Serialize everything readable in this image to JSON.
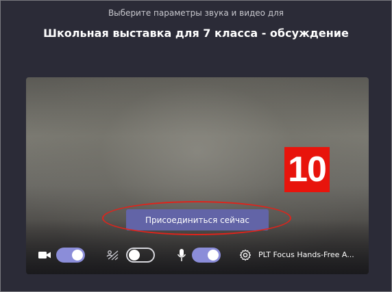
{
  "header": {
    "subtitle": "Выберите параметры звука и видео для",
    "title": "Школьная выставка для 7 класса - обсуждение"
  },
  "preview": {
    "badge_number": "10",
    "join_button_label": "Присоединиться сейчас"
  },
  "controls": {
    "camera": {
      "icon": "video-camera-icon",
      "toggle_on": true
    },
    "background_blur": {
      "icon": "background-blur-icon",
      "toggle_on": false
    },
    "microphone": {
      "icon": "microphone-icon",
      "toggle_on": true
    },
    "device_settings": {
      "icon": "gear-icon",
      "label": "PLT Focus Hands-Free A..."
    }
  },
  "colors": {
    "background": "#2b2b37",
    "accent": "#6264a7",
    "toggle_on": "#8b8dd9",
    "badge": "#e8140c",
    "highlight": "#e0231b"
  }
}
